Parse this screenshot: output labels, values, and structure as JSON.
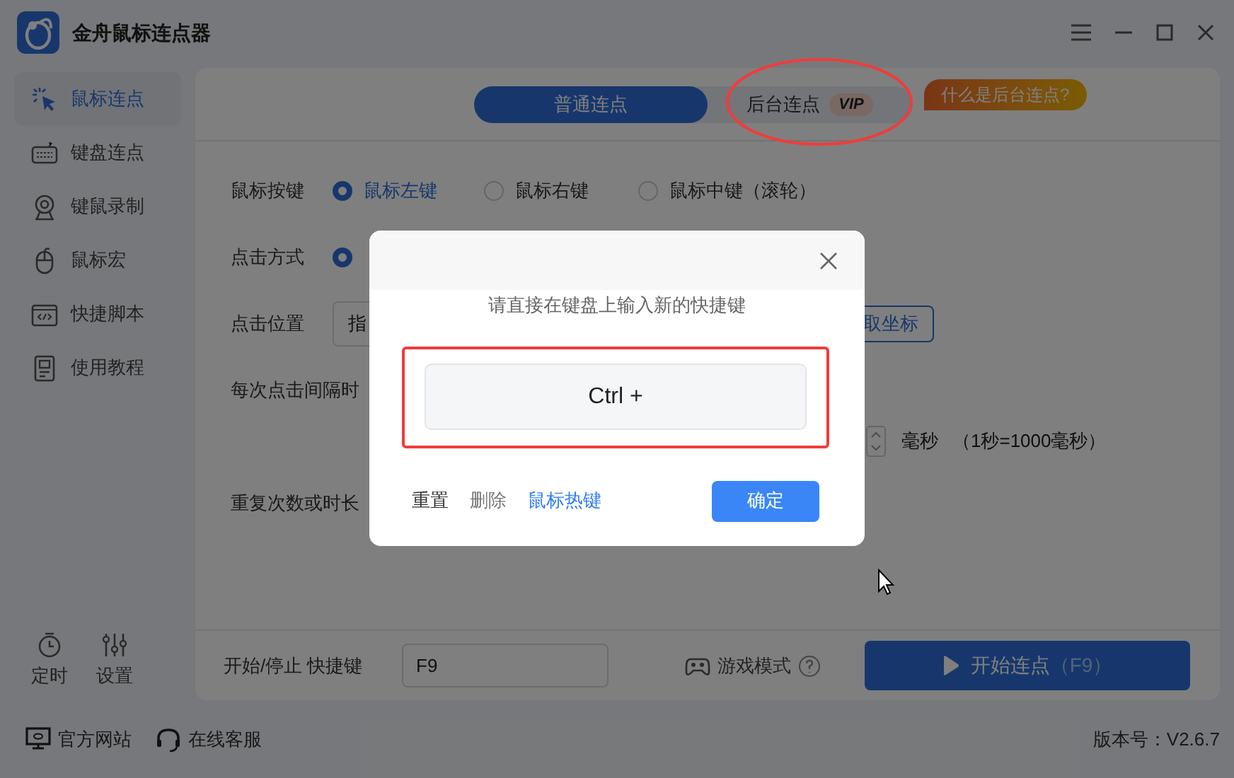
{
  "window": {
    "title": "金舟鼠标连点器"
  },
  "sidebar": {
    "items": [
      {
        "label": "鼠标连点",
        "selected": true,
        "kind": "click"
      },
      {
        "label": "键盘连点",
        "selected": false,
        "kind": "keyboard"
      },
      {
        "label": "键鼠录制",
        "selected": false,
        "kind": "record"
      },
      {
        "label": "鼠标宏",
        "selected": false,
        "kind": "mouse"
      },
      {
        "label": "快捷脚本",
        "selected": false,
        "kind": "script"
      },
      {
        "label": "使用教程",
        "selected": false,
        "kind": "doc"
      }
    ],
    "tools": [
      {
        "label": "定时",
        "kind": "timer"
      },
      {
        "label": "设置",
        "kind": "settings"
      }
    ]
  },
  "mode_tabs": [
    {
      "label": "普通连点",
      "selected": true
    },
    {
      "label": "后台连点",
      "selected": false,
      "badge": "VIP"
    }
  ],
  "help_badge": "什么是后台连点?",
  "form": {
    "mouse_button": {
      "label": "鼠标按键",
      "options": [
        {
          "label": "鼠标左键",
          "selected": true
        },
        {
          "label": "鼠标右键",
          "selected": false
        },
        {
          "label": "鼠标中键（滚轮）",
          "selected": false
        }
      ]
    },
    "click_mode": {
      "label": "点击方式",
      "options": [
        {
          "selected": true
        }
      ]
    },
    "click_position": {
      "label": "点击位置",
      "value": "指",
      "button": "取坐标"
    },
    "interval": {
      "label": "每次点击间隔时",
      "unit": "毫秒",
      "note": "（1秒=1000毫秒）"
    },
    "repeat": {
      "label": "重复次数或时长"
    }
  },
  "hotkey_bar": {
    "label": "开始/停止 快捷键",
    "value": "F9",
    "game_mode": "游戏模式",
    "start_label": "开始连点",
    "start_shortcut": "（F9）"
  },
  "footer": {
    "links": [
      {
        "label": "官方网站",
        "kind": "site"
      },
      {
        "label": "在线客服",
        "kind": "support"
      }
    ],
    "version": "版本号：V2.6.7"
  },
  "dialog": {
    "prompt": "请直接在键盘上输入新的快捷键",
    "hotkey_value": "Ctrl +",
    "actions": [
      {
        "label": "重置",
        "kind": "plain"
      },
      {
        "label": "删除",
        "kind": "muted"
      },
      {
        "label": "鼠标热键",
        "kind": "link"
      }
    ],
    "confirm": "确定"
  }
}
